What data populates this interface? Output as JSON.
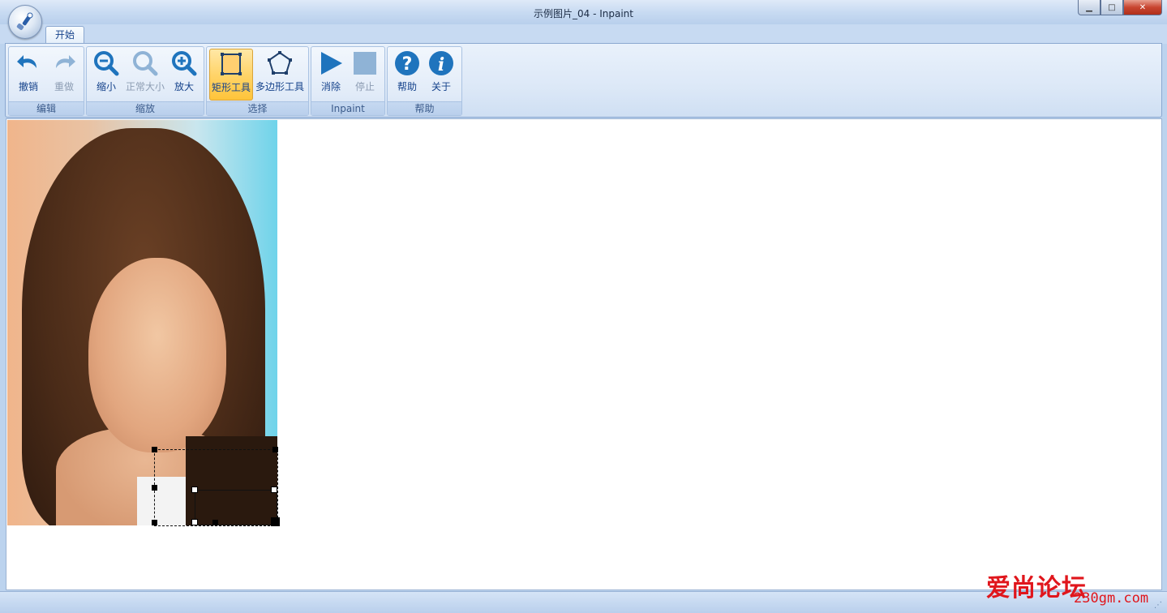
{
  "window": {
    "title": "示例图片_04 - Inpaint",
    "controls": {
      "minimize": "▁",
      "maximize": "□",
      "close": "✕"
    }
  },
  "ribbon": {
    "tabs": [
      {
        "label": "开始",
        "active": true
      }
    ],
    "groups": [
      {
        "name": "编辑",
        "buttons": [
          {
            "label": "撤销",
            "icon": "undo-icon",
            "enabled": true
          },
          {
            "label": "重做",
            "icon": "redo-icon",
            "enabled": false
          }
        ]
      },
      {
        "name": "缩放",
        "buttons": [
          {
            "label": "缩小",
            "icon": "zoom-out-icon",
            "enabled": true
          },
          {
            "label": "正常大小",
            "icon": "zoom-normal-icon",
            "enabled": false
          },
          {
            "label": "放大",
            "icon": "zoom-in-icon",
            "enabled": true
          }
        ]
      },
      {
        "name": "选择",
        "buttons": [
          {
            "label": "矩形工具",
            "icon": "rectangle-tool-icon",
            "enabled": true,
            "active": true
          },
          {
            "label": "多边形工具",
            "icon": "polygon-tool-icon",
            "enabled": true
          }
        ]
      },
      {
        "name": "Inpaint",
        "buttons": [
          {
            "label": "消除",
            "icon": "play-icon",
            "enabled": true
          },
          {
            "label": "停止",
            "icon": "stop-icon",
            "enabled": false
          }
        ]
      },
      {
        "name": "帮助",
        "buttons": [
          {
            "label": "帮助",
            "icon": "help-icon",
            "enabled": true
          },
          {
            "label": "关于",
            "icon": "info-icon",
            "enabled": true
          }
        ]
      }
    ]
  },
  "colors": {
    "accent": "#15428b",
    "active_tool": "#ffd46a",
    "icon_blue": "#1f74bd"
  },
  "watermark": {
    "text": "爱尚论坛",
    "url": "230gm.com"
  }
}
